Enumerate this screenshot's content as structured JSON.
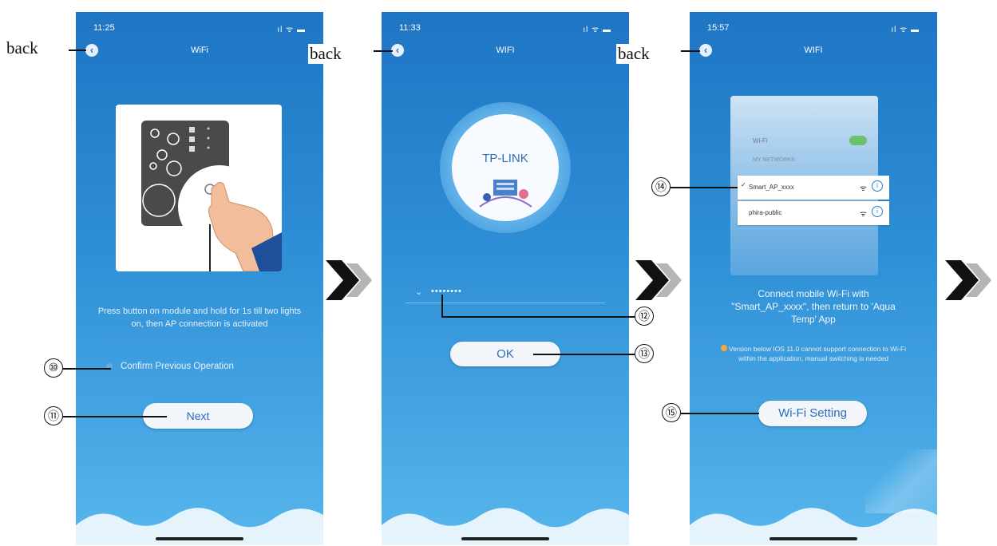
{
  "back_label": "back",
  "phones": [
    {
      "time": "11:25",
      "title": "WiFi",
      "instruction": "Press button on module and hold for 1s till two lights on, then AP connection is activated",
      "confirm_label": "Confirm Previous Operation",
      "next_label": "Next"
    },
    {
      "time": "11:33",
      "title": "WIFI",
      "brand": "TP-LINK",
      "password": "••••••••",
      "ok_label": "OK"
    },
    {
      "time": "15:57",
      "title": "WIFI",
      "ios_wifi_label": "Wi-Fi",
      "ios_my_networks": "MY NETWORKS",
      "network_1": "Smart_AP_xxxx",
      "network_2": "phira-public",
      "connect_text": "Connect mobile Wi-Fi with \"Smart_AP_xxxx\", then return to 'Aqua Temp' App",
      "version_note": "Version below IOS 11.0 cannot support connection to Wi-Fi within the application, manual switching is needed",
      "wifi_setting_label": "Wi-Fi Setting"
    }
  ],
  "callouts": [
    "⑩",
    "⑪",
    "⑫",
    "⑬",
    "⑭",
    "⑮"
  ],
  "status_icons": "ıl ᯤ ▬",
  "colors": {
    "accent": "#2e8fd6",
    "chevron_dark": "#111111",
    "chevron_light": "#b5b5b5"
  }
}
